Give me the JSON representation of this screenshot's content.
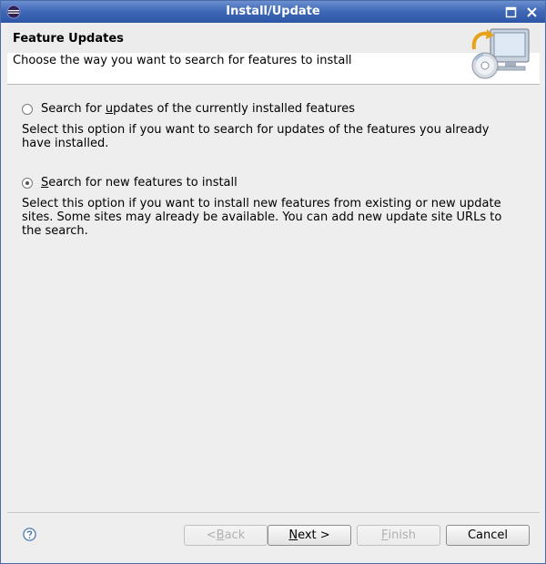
{
  "window": {
    "title": "Install/Update"
  },
  "banner": {
    "title": "Feature Updates",
    "description": "Choose the way you want to search for features to install"
  },
  "options": [
    {
      "label_pre": "Search for ",
      "label_mnemonic": "u",
      "label_post": "pdates of the currently installed features",
      "description": "Select this option if you want to search for updates of the features you already have installed.",
      "checked": false
    },
    {
      "label_pre": "",
      "label_mnemonic": "S",
      "label_post": "earch for new features to install",
      "description": "Select this option if you want to install new features from existing or new update sites. Some sites may already be available. You can add new update site URLs to the search.",
      "checked": true
    }
  ],
  "footer": {
    "back": {
      "mnemonic": "B",
      "pre": "< ",
      "post": "ack",
      "enabled": false
    },
    "next": {
      "mnemonic": "N",
      "pre": "",
      "post": "ext >",
      "enabled": true
    },
    "finish": {
      "mnemonic": "F",
      "pre": "",
      "post": "inish",
      "enabled": false
    },
    "cancel": {
      "label": "Cancel",
      "enabled": true
    }
  },
  "icons": {
    "app": "eclipse-icon",
    "maximize": "maximize-icon",
    "close": "close-icon",
    "help": "help-icon",
    "wizard": "install-wizard-graphic"
  },
  "colors": {
    "titlebar": "#3d66b5",
    "window_bg": "#eeeeee",
    "banner_bg": "#ffffff"
  }
}
